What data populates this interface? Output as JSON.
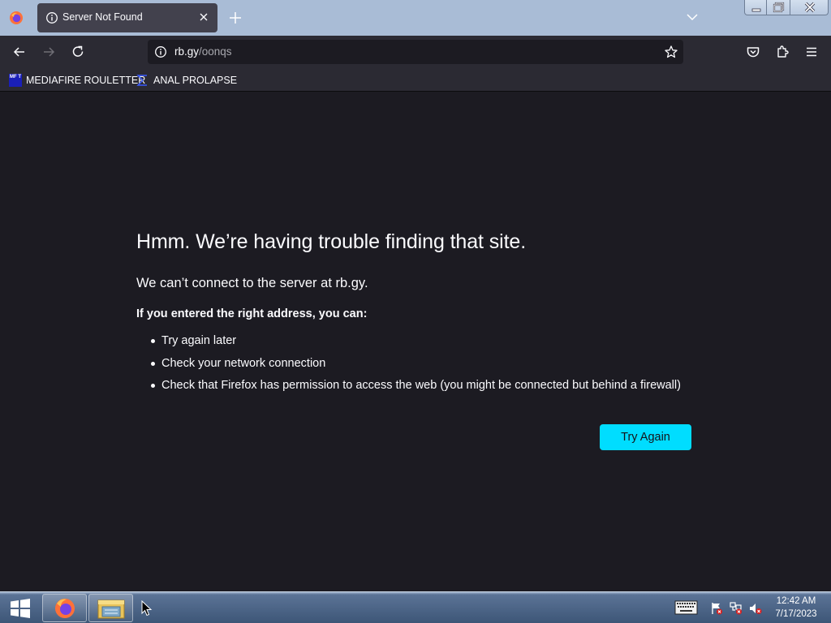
{
  "browser": {
    "tab_title": "Server Not Found",
    "url_host": "rb.gy",
    "url_path": "/oonqs"
  },
  "bookmarks": [
    {
      "label": "MEDIAFIRE ROULETTER",
      "icon": "mediafire-favicon",
      "icon_text": "MF T"
    },
    {
      "label": "ANAL PROLAPSE",
      "icon": "sigma-favicon"
    }
  ],
  "error_page": {
    "title": "Hmm. We’re having trouble finding that site.",
    "short_desc": "We can’t connect to the server at rb.gy.",
    "hint": "If you entered the right address, you can:",
    "suggestions": [
      "Try again later",
      "Check your network connection",
      "Check that Firefox has permission to access the web (you might be connected but behind a firewall)"
    ],
    "try_again_label": "Try Again"
  },
  "taskbar": {
    "time": "12:42 AM",
    "date": "7/17/2023"
  },
  "colors": {
    "accent": "#00ddff",
    "page_bg": "#1c1b22",
    "toolbar_bg": "#2b2a33",
    "tab_bg": "#42414d"
  }
}
